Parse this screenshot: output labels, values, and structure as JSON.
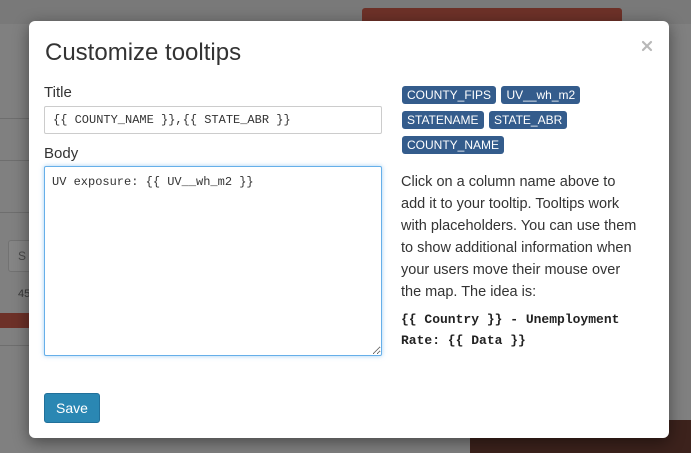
{
  "background": {
    "search_box_initial": "S",
    "value_label": "45"
  },
  "modal": {
    "title": "Customize tooltips",
    "close_icon": "close-icon",
    "title_field": {
      "label": "Title",
      "value": "{{ COUNTY_NAME }},{{ STATE_ABR }}"
    },
    "body_field": {
      "label": "Body",
      "value": "UV exposure: {{ UV__wh_m2 }}"
    },
    "column_chips": [
      {
        "label": "COUNTY_FIPS"
      },
      {
        "label": "UV__wh_m2"
      },
      {
        "label": "STATENAME"
      },
      {
        "label": "STATE_ABR"
      },
      {
        "label": "COUNTY_NAME"
      }
    ],
    "help_text": "Click on a column name above to add it to your tooltip. Tooltips work with placeholders. You can use them to show additional information when your users move their mouse over the map. The idea is:",
    "example": "{{ Country }} - Unemployment Rate: {{ Data }}",
    "save_label": "Save"
  },
  "colors": {
    "chip": "#345c8c",
    "save_button": "#2a87b3",
    "focus_border": "#66afe9"
  }
}
